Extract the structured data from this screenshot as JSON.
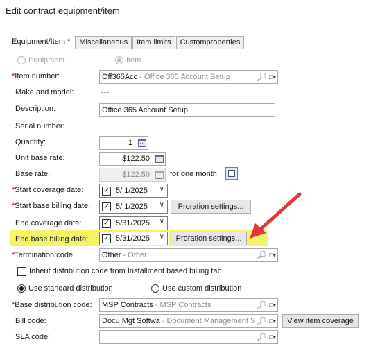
{
  "window": {
    "title": "Edit contract equipment/item"
  },
  "tabs": [
    "Equipment/Item *",
    "Miscellaneous",
    "Item limits",
    "Customproperties"
  ],
  "type_radios": {
    "equipment": "Equipment",
    "item": "Item"
  },
  "item_number": {
    "label": "*Item number:",
    "code": "Off365Acc",
    "desc": " - Office 365 Account Setup"
  },
  "make_model": {
    "label": "Make and model:",
    "value": "---"
  },
  "description": {
    "label": "Description:",
    "value": "Office 365 Account Setup"
  },
  "serial": {
    "label": "Serial number:"
  },
  "quantity": {
    "label": "Quantity:",
    "value": "1"
  },
  "unit_base_rate": {
    "label": "Unit base rate:",
    "value": "$122.50"
  },
  "base_rate": {
    "label": "Base rate:",
    "value": "$122.50",
    "suffix": "for one month"
  },
  "start_coverage": {
    "label": "*Start coverage date:",
    "value": "5/  1/2025"
  },
  "start_billing": {
    "label": "*Start base billing date:",
    "value": "5/  1/2025",
    "button": "Proration settings..."
  },
  "end_coverage": {
    "label": "End coverage date:",
    "value": "5/31/2025"
  },
  "end_billing": {
    "label": "End base billing date:",
    "value": "5/31/2025",
    "button": "Proration settings..."
  },
  "termination": {
    "label": "*Termination code:",
    "code": "Other",
    "desc": " - Other"
  },
  "inherit": {
    "label": "Inherit distribution code from Installment based billing tab"
  },
  "distribution": {
    "standard": "Use standard distribution",
    "custom": "Use custom distribution"
  },
  "base_distribution": {
    "label": "*Base distribution code:",
    "code": "MSP Contracts",
    "desc": " - MSP Contracts"
  },
  "bill_code": {
    "label": "Bill code:",
    "code": "Docu Mgt Softwa",
    "desc": " - Document Management So",
    "button": "View item coverage"
  },
  "sla_code": {
    "label": "SLA code:"
  },
  "colors": {
    "highlight": "#f4f36a",
    "arrow": "#e0393a",
    "required": "#c00000"
  }
}
